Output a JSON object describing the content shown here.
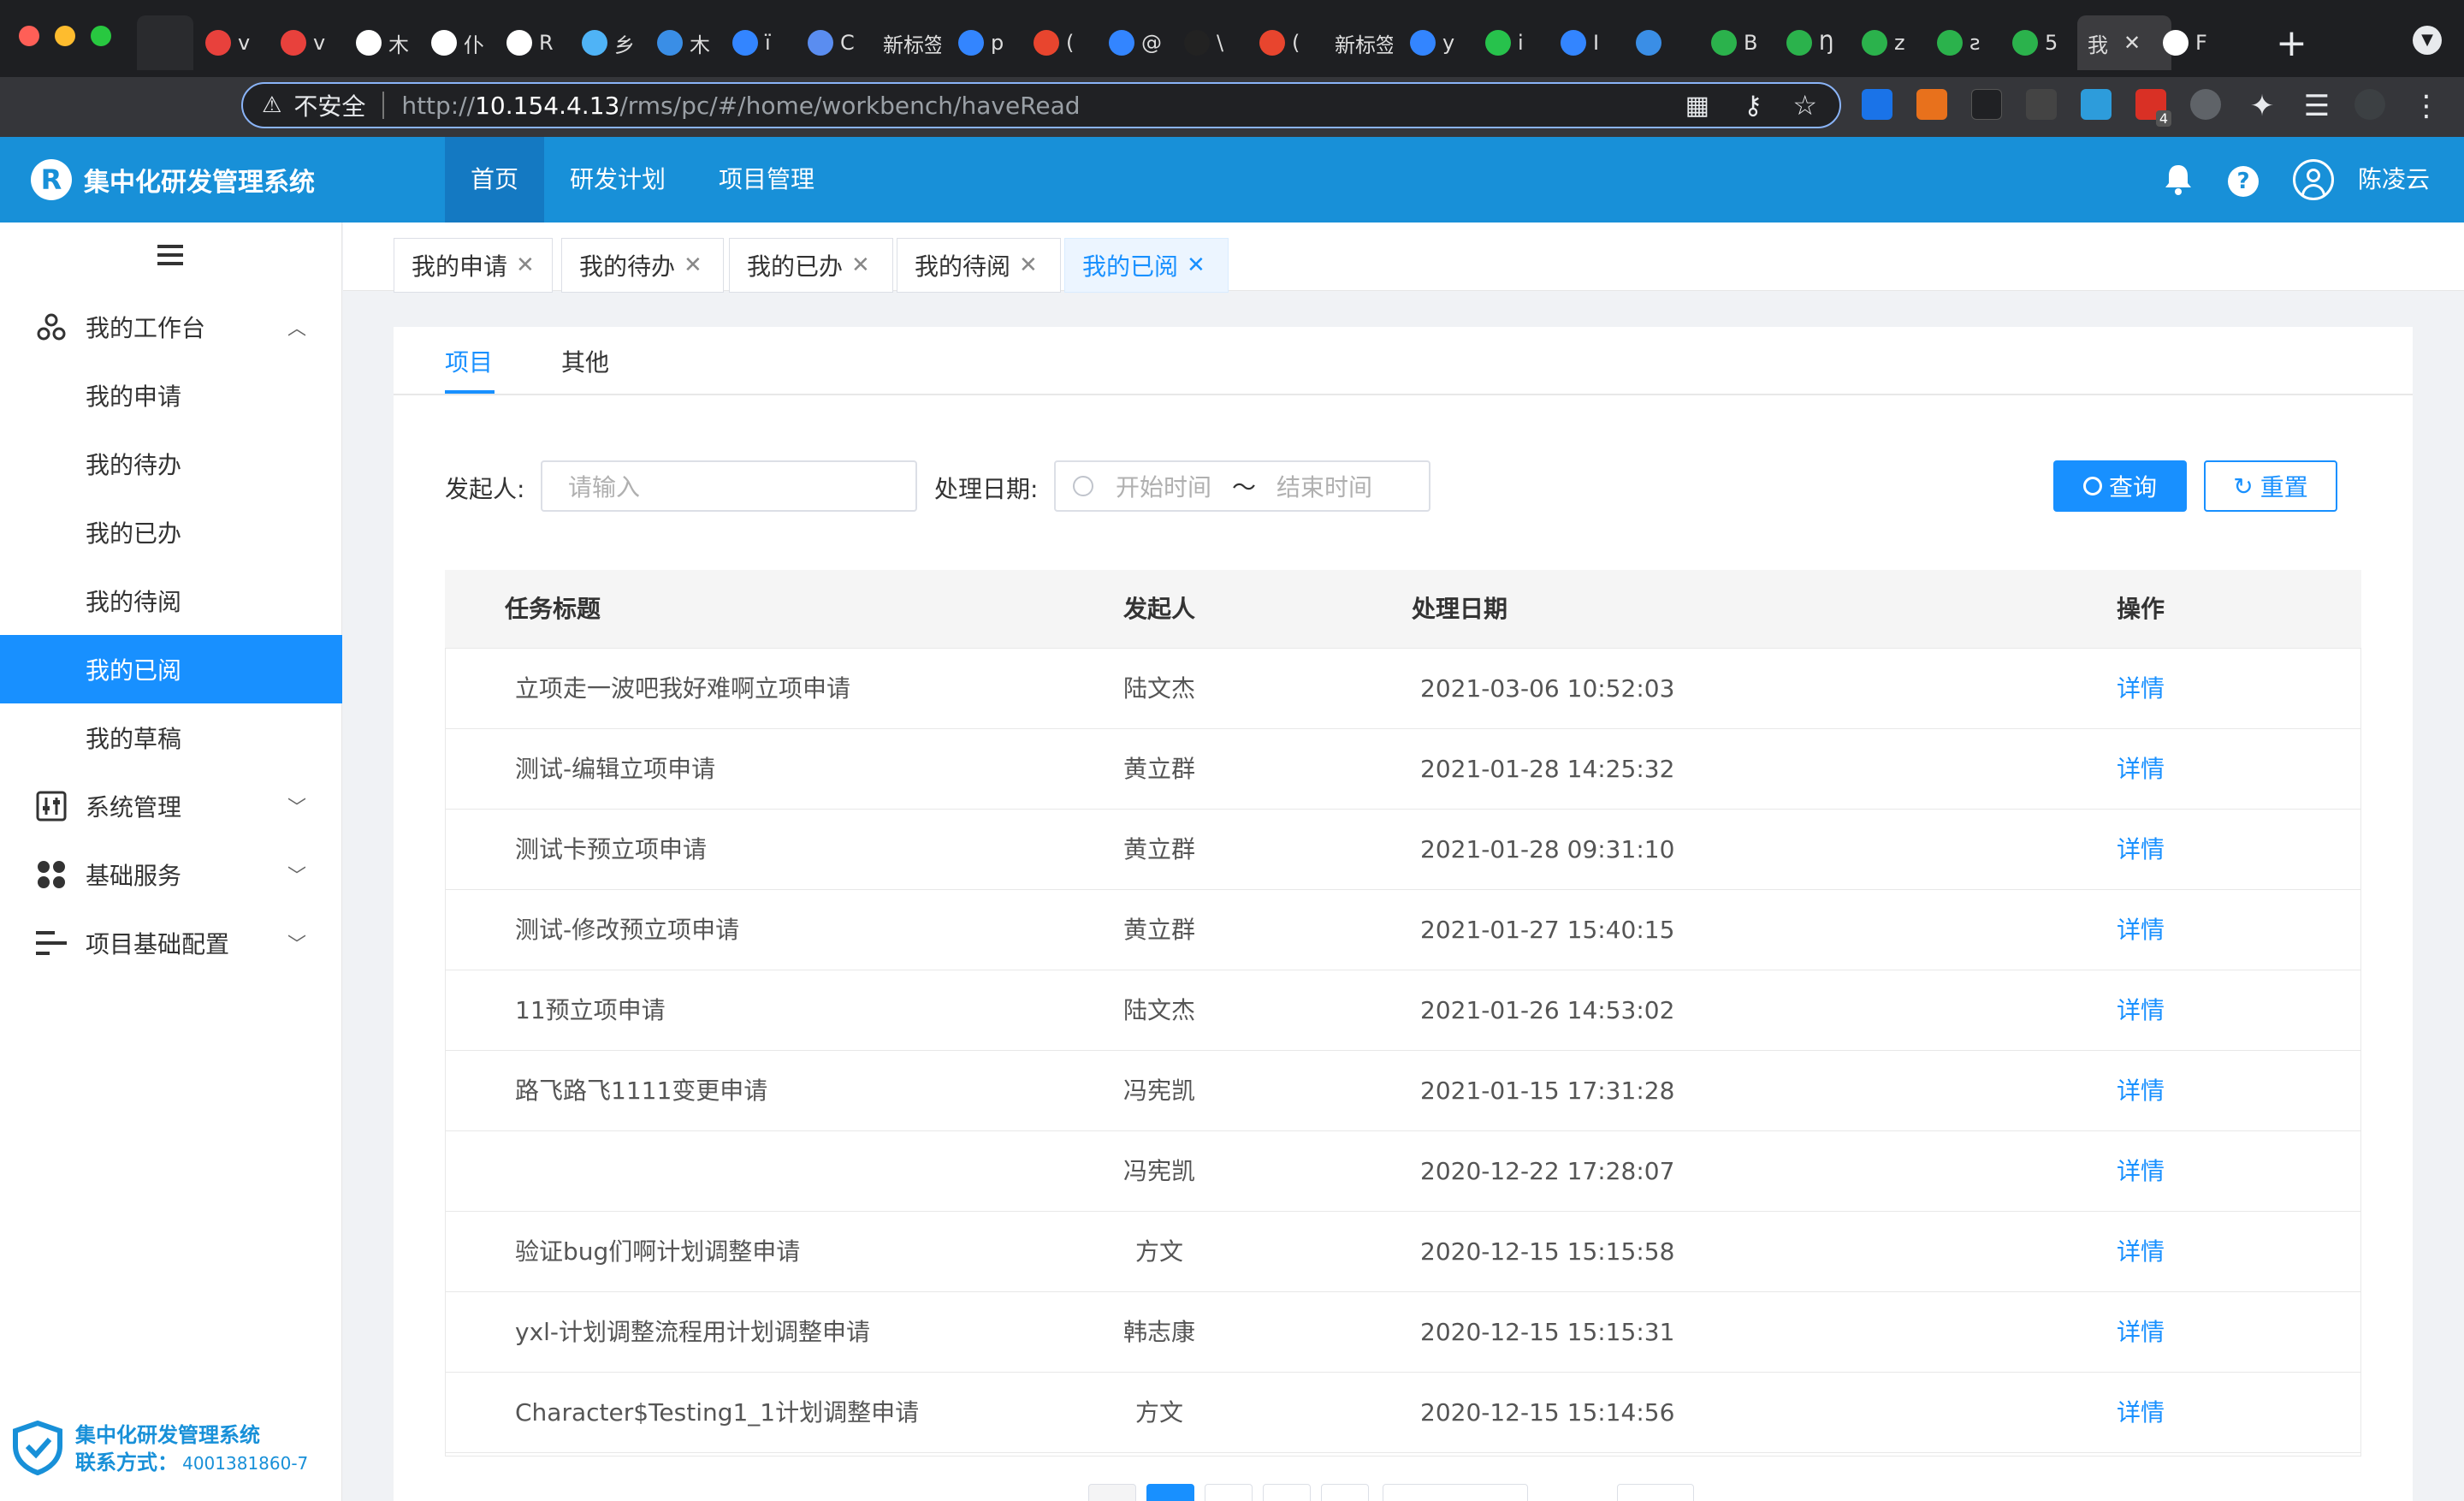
{
  "browser": {
    "tabs": [
      {
        "label": "v",
        "icon": "bilibili-icon",
        "color": "#e8413c"
      },
      {
        "label": "v",
        "icon": "bilibili-icon",
        "color": "#e8413c"
      },
      {
        "label": "木",
        "icon": "globe-icon",
        "color": "#ffffff"
      },
      {
        "label": "仆",
        "icon": "globe-icon",
        "color": "#ffffff"
      },
      {
        "label": "R",
        "icon": "globe-icon",
        "color": "#ffffff"
      },
      {
        "label": "乡",
        "icon": "cube-icon",
        "color": "#4fb3f6"
      },
      {
        "label": "木",
        "icon": "feather-icon",
        "color": "#3a8ee6"
      },
      {
        "label": "ï",
        "icon": "paw-icon",
        "color": "#3385ff"
      },
      {
        "label": "C",
        "icon": "translate-icon",
        "color": "#5a8df0"
      },
      {
        "label": "新标签",
        "icon": "",
        "color": ""
      },
      {
        "label": "p",
        "icon": "paw-icon",
        "color": "#3385ff"
      },
      {
        "label": "(",
        "icon": "c-icon",
        "color": "#e8452e"
      },
      {
        "label": "@",
        "icon": "paw-icon",
        "color": "#3385ff"
      },
      {
        "label": "\\",
        "icon": "github-icon",
        "color": "#222222"
      },
      {
        "label": "(",
        "icon": "c-icon",
        "color": "#e8452e"
      },
      {
        "label": "新标签",
        "icon": "",
        "color": ""
      },
      {
        "label": "y",
        "icon": "paw-icon",
        "color": "#3385ff"
      },
      {
        "label": "i",
        "icon": "wechat-icon",
        "color": "#27c24c"
      },
      {
        "label": "I",
        "icon": "paw-icon",
        "color": "#3385ff"
      },
      {
        "label": "",
        "icon": "edge-icon",
        "color": "#3a8ee6"
      },
      {
        "label": "B",
        "icon": "play-icon",
        "color": "#2bb24c"
      },
      {
        "label": "Ŋ",
        "icon": "play-icon",
        "color": "#2bb24c"
      },
      {
        "label": "z",
        "icon": "play-icon",
        "color": "#2bb24c"
      },
      {
        "label": "ƨ",
        "icon": "play-icon",
        "color": "#2bb24c"
      },
      {
        "label": "5",
        "icon": "play-icon",
        "color": "#2bb24c"
      },
      {
        "label": "我",
        "icon": "",
        "color": "",
        "active": true
      },
      {
        "label": "F",
        "icon": "globe-icon",
        "color": "#ffffff"
      }
    ],
    "security": "不安全",
    "url_prefix": "http://",
    "url_host": "10.154.4.13",
    "url_path": "/rms/pc/#/home/workbench/haveRead",
    "ext_badge": "4"
  },
  "app": {
    "name": "集中化研发管理系统",
    "nav": [
      "首页",
      "研发计划",
      "项目管理"
    ],
    "user": "陈凌云",
    "brand_color": "#1890d8",
    "accent": "#1890ff"
  },
  "sidebar": {
    "workbench": "我的工作台",
    "items": [
      "我的申请",
      "我的待办",
      "我的已办",
      "我的待阅",
      "我的已阅",
      "我的草稿"
    ],
    "groups": [
      "系统管理",
      "基础服务",
      "项目基础配置"
    ],
    "footer_title": "集中化研发管理系统",
    "footer_contact_label": "联系方式：",
    "footer_phone": "4001381860-7"
  },
  "tags": [
    "我的申请",
    "我的待办",
    "我的已办",
    "我的待阅",
    "我的已阅"
  ],
  "content_tabs": [
    "项目",
    "其他"
  ],
  "filter": {
    "initiator_label": "发起人:",
    "initiator_placeholder": "请输入",
    "date_label": "处理日期:",
    "start_placeholder": "开始时间",
    "separator": "～",
    "end_placeholder": "结束时间",
    "query": "查询",
    "reset": "重置"
  },
  "table": {
    "headers": [
      "任务标题",
      "发起人",
      "处理日期",
      "操作"
    ],
    "rows": [
      {
        "title": "立项走一波吧我好难啊立项申请",
        "initiator": "陆文杰",
        "date": "2021-03-06 10:52:03",
        "op": "详情"
      },
      {
        "title": "测试-编辑立项申请",
        "initiator": "黄立群",
        "date": "2021-01-28 14:25:32",
        "op": "详情"
      },
      {
        "title": "测试卡预立项申请",
        "initiator": "黄立群",
        "date": "2021-01-28 09:31:10",
        "op": "详情"
      },
      {
        "title": "测试-修改预立项申请",
        "initiator": "黄立群",
        "date": "2021-01-27 15:40:15",
        "op": "详情"
      },
      {
        "title": "11预立项申请",
        "initiator": "陆文杰",
        "date": "2021-01-26 14:53:02",
        "op": "详情"
      },
      {
        "title": "路飞路飞1111变更申请",
        "initiator": "冯宪凯",
        "date": "2021-01-15 17:31:28",
        "op": "详情"
      },
      {
        "title": "",
        "initiator": "冯宪凯",
        "date": "2020-12-22 17:28:07",
        "op": "详情"
      },
      {
        "title": "验证bug们啊计划调整申请",
        "initiator": "方文",
        "date": "2020-12-15 15:15:58",
        "op": "详情"
      },
      {
        "title": "yxl-计划调整流程用计划调整申请",
        "initiator": "韩志康",
        "date": "2020-12-15 15:15:31",
        "op": "详情"
      },
      {
        "title": "Character$Testing1_1计划调整申请",
        "initiator": "方文",
        "date": "2020-12-15 15:14:56",
        "op": "详情"
      }
    ]
  }
}
